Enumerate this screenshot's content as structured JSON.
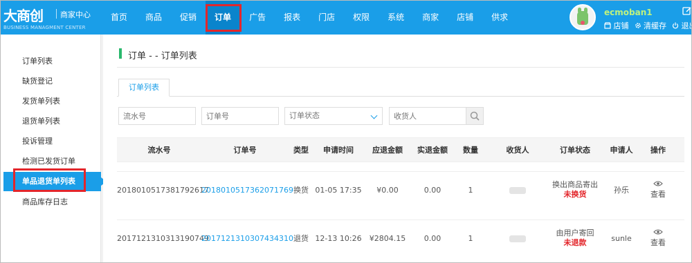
{
  "logo": {
    "main": "大商创",
    "sub": "商家中心",
    "en": "BUSINESS MANAGMENT CENTER"
  },
  "nav": [
    "首页",
    "商品",
    "促销",
    "订单",
    "广告",
    "报表",
    "门店",
    "权限",
    "系统",
    "商家",
    "店铺",
    "供求"
  ],
  "nav_active": "订单",
  "user": {
    "name": "ecmoban1",
    "links": [
      "店铺",
      "清缓存",
      "退出"
    ]
  },
  "sidebar": [
    "订单列表",
    "缺货登记",
    "发货单列表",
    "退货单列表",
    "投诉管理",
    "检测已发货订单",
    "单品退货单列表",
    "商品库存日志"
  ],
  "sidebar_active": "单品退货单列表",
  "page": {
    "title": "订单 - - 订单列表",
    "tab": "订单列表"
  },
  "filters": {
    "serial_placeholder": "流水号",
    "order_placeholder": "订单号",
    "status_value": "订单状态",
    "consignee_placeholder": "收货人"
  },
  "table": {
    "headers": [
      "流水号",
      "订单号",
      "类型",
      "申请时间",
      "应退金额",
      "实退金额",
      "数量",
      "收货人",
      "订单状态",
      "申请人",
      "操作"
    ],
    "rows": [
      {
        "serial": "2018010517381792617",
        "order": "2018010517362071769",
        "type": "换货",
        "time": "01-05 17:35",
        "due": "¥0.00",
        "refunded": "0.00",
        "qty": "1",
        "status_line1": "换出商品寄出",
        "status_line2": "未换货",
        "applicant": "孙乐",
        "action": "查看"
      },
      {
        "serial": "2017121310313190749",
        "order": "2017121310307434310",
        "type": "退货",
        "time": "12-13 10:26",
        "due": "¥2804.15",
        "refunded": "0.00",
        "qty": "1",
        "status_line1": "由用户寄回",
        "status_line2": "未退款",
        "applicant": "sunle",
        "action": "查看"
      }
    ]
  },
  "colors": {
    "brand": "#1a9ee8",
    "highlight": "#e3262b",
    "title_marker": "#2ab86d"
  }
}
